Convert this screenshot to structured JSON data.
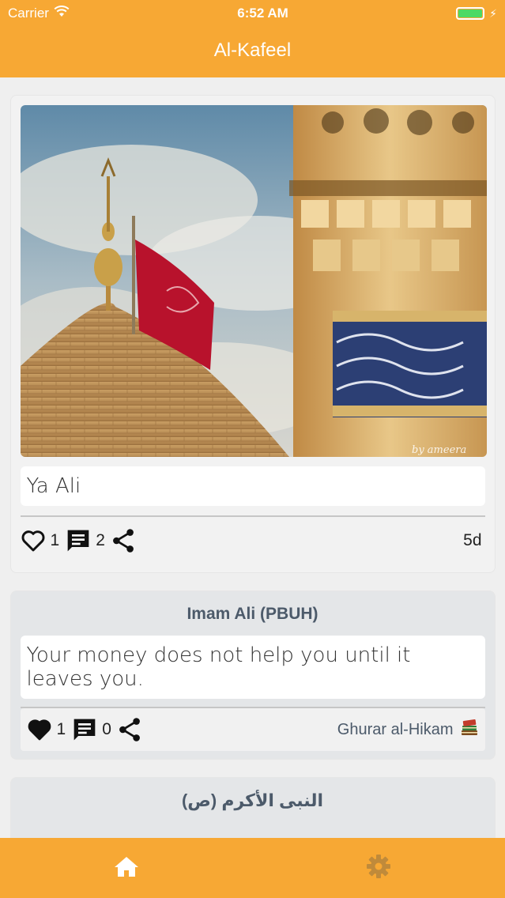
{
  "status": {
    "carrier": "Carrier",
    "time": "6:52 AM"
  },
  "nav": {
    "title": "Al-Kafeel"
  },
  "colors": {
    "accent": "#f7a834",
    "quote_title": "#4c5a6a",
    "settings_icon": "#c08a3a"
  },
  "posts": [
    {
      "type": "photo",
      "caption": "Ya Ali",
      "likes": "1",
      "liked": false,
      "comments": "2",
      "time_ago": "5d"
    },
    {
      "type": "quote",
      "author": "Imam Ali (PBUH)",
      "text": "Your money does not help you until it leaves you.",
      "likes": "1",
      "liked": true,
      "comments": "0",
      "source": "Ghurar al-Hikam"
    },
    {
      "type": "quote",
      "author": "النبى الأكرم (ص)"
    }
  ],
  "tabs": [
    {
      "icon": "home-icon",
      "active": true
    },
    {
      "icon": "gear-icon",
      "active": false
    }
  ]
}
